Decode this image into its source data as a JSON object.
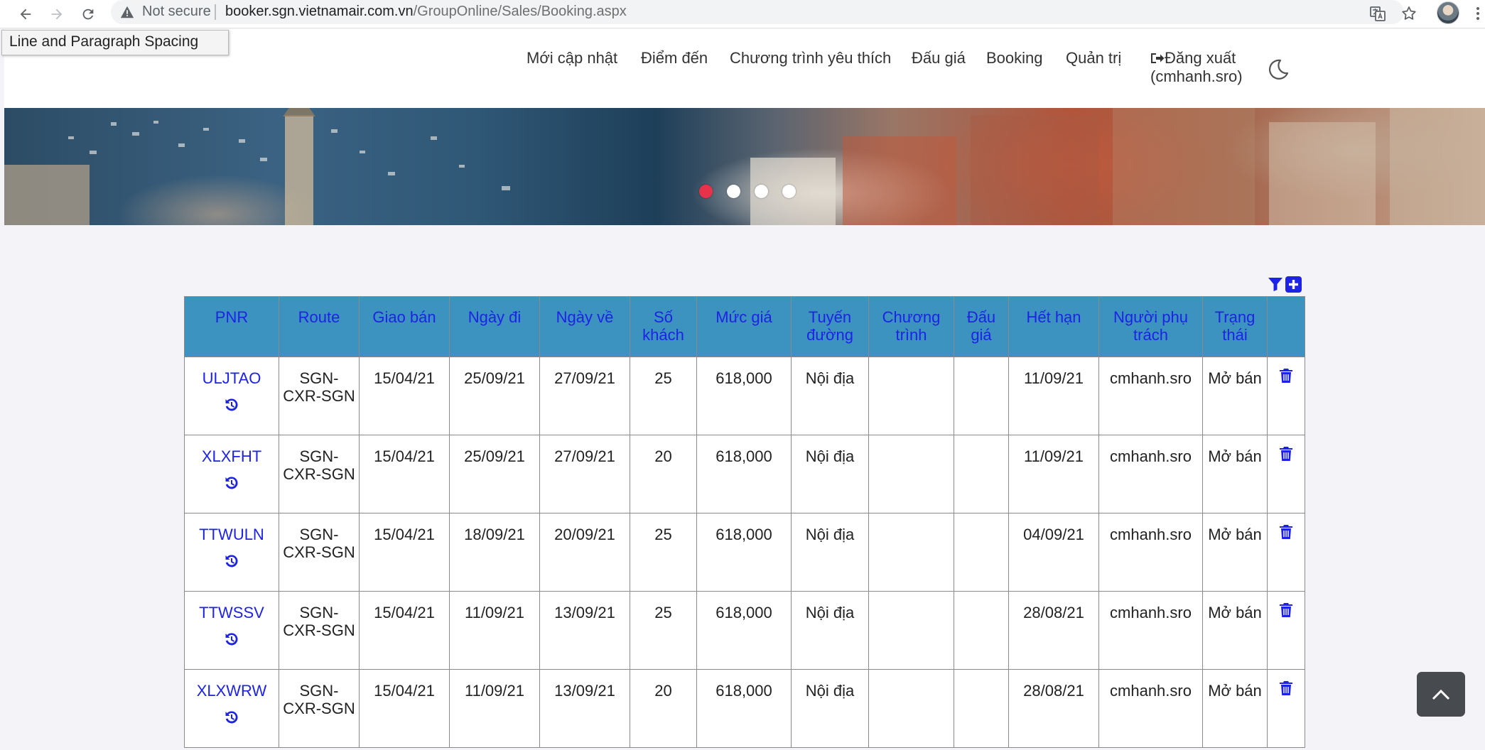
{
  "browser": {
    "security_label": "Not secure",
    "url_host": "booker.sgn.vietnamair.com.vn",
    "url_path": "/GroupOnline/Sales/Booking.aspx"
  },
  "tooltip": "Line and Paragraph Spacing",
  "nav": {
    "items": [
      "Mới cập nhật",
      "Điểm đến",
      "Chương trình yêu thích",
      "Đấu giá",
      "Booking",
      "Quản trị"
    ],
    "logout_label": "Đăng xuất",
    "logout_user": "(cmhanh.sro)"
  },
  "carousel": {
    "slide_count": 4,
    "active_index": 0
  },
  "table": {
    "headers": [
      "PNR",
      "Route",
      "Giao bán",
      "Ngày đi",
      "Ngày về",
      "Số khách",
      "Mức giá",
      "Tuyến đường",
      "Chương trình",
      "Đấu giá",
      "Hết hạn",
      "Người phụ trách",
      "Trạng thái",
      ""
    ],
    "rows": [
      {
        "pnr": "ULJTAO",
        "route": "SGN-CXR-SGN",
        "giao_ban": "15/04/21",
        "ngay_di": "25/09/21",
        "ngay_ve": "27/09/21",
        "so_khach": "25",
        "muc_gia": "618,000",
        "tuyen_duong": "Nội địa",
        "chuong_trinh": "",
        "dau_gia": "",
        "het_han": "11/09/21",
        "nguoi_phu_trach": "cmhanh.sro",
        "trang_thai": "Mở bán"
      },
      {
        "pnr": "XLXFHT",
        "route": "SGN-CXR-SGN",
        "giao_ban": "15/04/21",
        "ngay_di": "25/09/21",
        "ngay_ve": "27/09/21",
        "so_khach": "20",
        "muc_gia": "618,000",
        "tuyen_duong": "Nội địa",
        "chuong_trinh": "",
        "dau_gia": "",
        "het_han": "11/09/21",
        "nguoi_phu_trach": "cmhanh.sro",
        "trang_thai": "Mở bán"
      },
      {
        "pnr": "TTWULN",
        "route": "SGN-CXR-SGN",
        "giao_ban": "15/04/21",
        "ngay_di": "18/09/21",
        "ngay_ve": "20/09/21",
        "so_khach": "25",
        "muc_gia": "618,000",
        "tuyen_duong": "Nội địa",
        "chuong_trinh": "",
        "dau_gia": "",
        "het_han": "04/09/21",
        "nguoi_phu_trach": "cmhanh.sro",
        "trang_thai": "Mở bán"
      },
      {
        "pnr": "TTWSSV",
        "route": "SGN-CXR-SGN",
        "giao_ban": "15/04/21",
        "ngay_di": "11/09/21",
        "ngay_ve": "13/09/21",
        "so_khach": "25",
        "muc_gia": "618,000",
        "tuyen_duong": "Nội địa",
        "chuong_trinh": "",
        "dau_gia": "",
        "het_han": "28/08/21",
        "nguoi_phu_trach": "cmhanh.sro",
        "trang_thai": "Mở bán"
      },
      {
        "pnr": "XLXWRW",
        "route": "SGN-CXR-SGN",
        "giao_ban": "15/04/21",
        "ngay_di": "11/09/21",
        "ngay_ve": "13/09/21",
        "so_khach": "20",
        "muc_gia": "618,000",
        "tuyen_duong": "Nội địa",
        "chuong_trinh": "",
        "dau_gia": "",
        "het_han": "28/08/21",
        "nguoi_phu_trach": "cmhanh.sro",
        "trang_thai": "Mở bán"
      }
    ]
  },
  "colors": {
    "header_bg": "#3d93bf",
    "link_blue": "#1d23e6",
    "dot_active": "#e8324a",
    "scroll_top_bg": "#474a4f"
  },
  "icons": {
    "back": "arrow-left-icon",
    "forward": "arrow-right-icon",
    "reload": "reload-icon",
    "warning": "warning-triangle-icon",
    "translate": "translate-icon",
    "bookmark": "star-icon",
    "menu": "kebab-menu-icon",
    "logout": "sign-out-icon",
    "theme": "moon-icon",
    "filter": "filter-icon",
    "add": "plus-square-icon",
    "history": "history-icon",
    "delete": "trash-icon",
    "scroll_top": "chevron-up-icon"
  }
}
